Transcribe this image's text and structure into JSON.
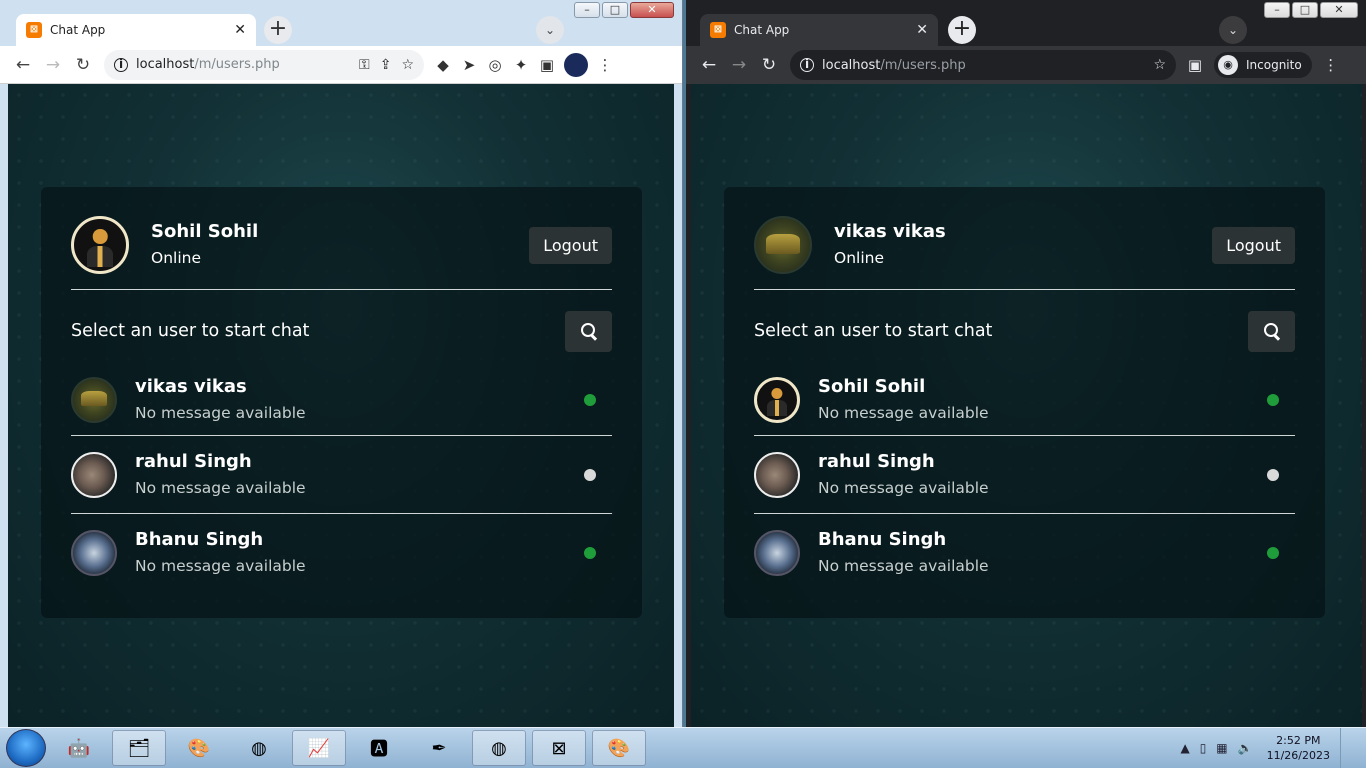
{
  "windows": [
    {
      "id": "left",
      "tab_title": "Chat App",
      "url_host": "localhost",
      "url_path": "/m/users.php",
      "current_user": {
        "name": "Sohil Sohil",
        "status": "Online",
        "avatar": "suit-avatar"
      },
      "logout_label": "Logout",
      "search_label": "Select an user to start chat",
      "users": [
        {
          "name": "vikas vikas",
          "message": "No message available",
          "online": true,
          "avatar": "emblem-avatar"
        },
        {
          "name": "rahul Singh",
          "message": "No message available",
          "online": false,
          "avatar": "rock-avatar"
        },
        {
          "name": "Bhanu Singh",
          "message": "No message available",
          "online": true,
          "avatar": "wolf-avatar"
        }
      ]
    },
    {
      "id": "right",
      "tab_title": "Chat App",
      "url_host": "localhost",
      "url_path": "/m/users.php",
      "incognito_label": "Incognito",
      "current_user": {
        "name": "vikas vikas",
        "status": "Online",
        "avatar": "emblem-avatar"
      },
      "logout_label": "Logout",
      "search_label": "Select an user to start chat",
      "users": [
        {
          "name": "Sohil Sohil",
          "message": "No message available",
          "online": true,
          "avatar": "suit-avatar"
        },
        {
          "name": "rahul Singh",
          "message": "No message available",
          "online": false,
          "avatar": "rock-avatar"
        },
        {
          "name": "Bhanu Singh",
          "message": "No message available",
          "online": true,
          "avatar": "wolf-avatar"
        }
      ]
    }
  ],
  "colors": {
    "online": "#1f9d3a",
    "offline": "#d9d9d9",
    "tab_favicon": "#f57c00"
  },
  "taskbar": {
    "clock_time": "2:52 PM",
    "clock_date": "11/26/2023"
  }
}
